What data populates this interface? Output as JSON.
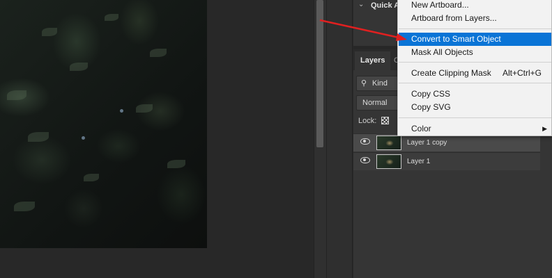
{
  "panels": {
    "quick_actions_title": "Quick A",
    "tabs": [
      "Layers",
      "C"
    ],
    "kind_filter": "Kind",
    "blend_mode": "Normal",
    "lock_label": "Lock:"
  },
  "layers": [
    {
      "name": "Layer 1 copy",
      "selected": true
    },
    {
      "name": "Layer 1",
      "selected": false
    }
  ],
  "context_menu": {
    "items": {
      "new_artboard": "New Artboard...",
      "artboard_from_layers": "Artboard from Layers...",
      "convert_smart_object": "Convert to Smart Object",
      "mask_all_objects": "Mask All Objects",
      "create_clipping_mask": "Create Clipping Mask",
      "create_clipping_mask_shortcut": "Alt+Ctrl+G",
      "copy_css": "Copy CSS",
      "copy_svg": "Copy SVG",
      "color": "Color"
    },
    "highlighted": "Convert to Smart Object"
  },
  "colors": {
    "highlight": "#0a74d6",
    "annotation_arrow": "#e02020"
  },
  "icons": [
    "chevron-down-icon",
    "search-icon",
    "lock-transparency-icon",
    "eye-icon",
    "submenu-arrow-icon"
  ]
}
